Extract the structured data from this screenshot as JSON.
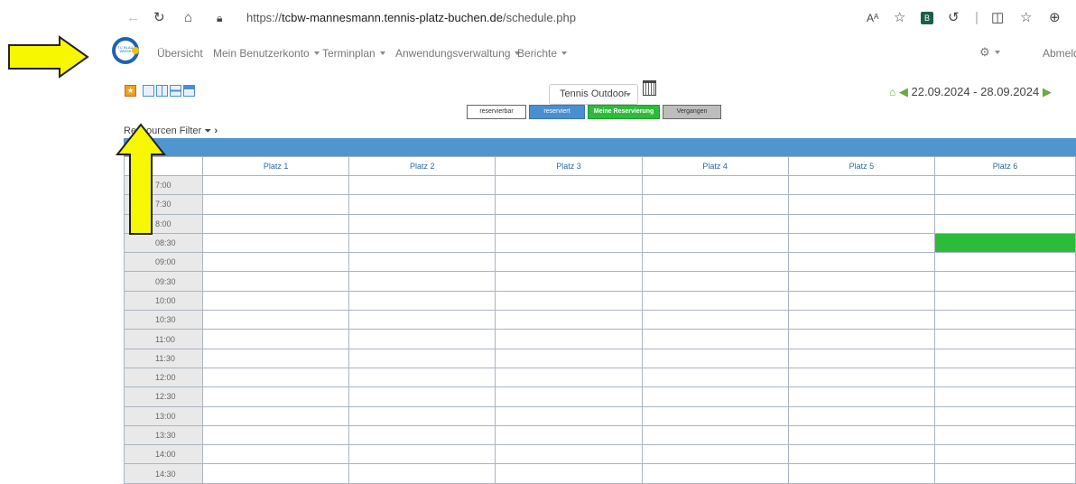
{
  "browser": {
    "url_prefix": "https://",
    "url_domain": "tcbw-mannesmann.tennis-platz-buchen.de",
    "url_path": "/schedule.php",
    "icons": [
      "back-icon",
      "refresh-icon",
      "home-icon",
      "site-info-icon",
      "read-aloud-icon",
      "favorite-icon",
      "extension-icon",
      "copilot-icon",
      "split-screen-icon",
      "favorites-list-icon",
      "collections-icon",
      "profile-icon"
    ]
  },
  "nav": {
    "logo_text": "TC BLAU WEISS",
    "items": [
      "Übersicht",
      "Mein Benutzerkonto",
      "Terminplan",
      "Anwendungsverwaltung",
      "Berichte"
    ],
    "logout": "Abmelde"
  },
  "toolbar": {
    "resource_select": "Tennis Outdoor",
    "date_range": "22.09.2024 - 28.09.2024",
    "filter_label": "Ressourcen Filter",
    "legend": {
      "reservable": "reservierbar",
      "reserved": "reserviert",
      "mine": "Meine Reservierung",
      "past": "Vergangen"
    }
  },
  "schedule": {
    "day_header": ".09.24",
    "columns": [
      "Platz 1",
      "Platz 2",
      "Platz 3",
      "Platz 4",
      "Platz 5",
      "Platz 6"
    ],
    "rows": [
      {
        "time": "7:00"
      },
      {
        "time": "7:30"
      },
      {
        "time": "8:00"
      },
      {
        "time": "08:30"
      },
      {
        "time": "09:00"
      },
      {
        "time": "09:30"
      },
      {
        "time": "10:00"
      },
      {
        "time": "10:30"
      },
      {
        "time": "11:00"
      },
      {
        "time": "11:30"
      },
      {
        "time": "12:00"
      },
      {
        "time": "12:30"
      },
      {
        "time": "13:00"
      },
      {
        "time": "13:30"
      },
      {
        "time": "14:00"
      },
      {
        "time": "14:30"
      }
    ],
    "booked": {
      "row_time": "08:30",
      "column": "Platz 6",
      "status": "Meine Reservierung"
    }
  },
  "colors": {
    "header_blue": "#4f95d0",
    "reserved_blue": "#4a8fd0",
    "mine_green": "#2dbb3a",
    "past_gray": "#bdbdbd",
    "annotation_arrow": "#f7f700"
  }
}
